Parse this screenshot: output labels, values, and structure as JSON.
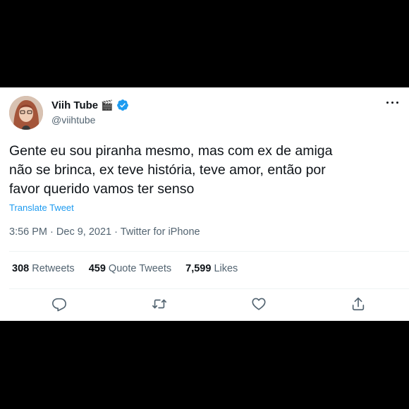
{
  "author": {
    "display_name": "Viih Tube",
    "name_emoji": "🎬",
    "handle": "@viihtube",
    "verified": true
  },
  "tweet": {
    "text": "Gente eu sou piranha mesmo, mas com ex de amiga\nnão se brinca, ex teve história, teve amor, então por\nfavor querido vamos ter senso",
    "translate_label": "Translate Tweet",
    "time": "3:56 PM",
    "date": "Dec 9, 2021",
    "source": "Twitter for iPhone",
    "separator": "·"
  },
  "stats": {
    "retweets_count": "308",
    "retweets_label": "Retweets",
    "quotes_count": "459",
    "quotes_label": "Quote Tweets",
    "likes_count": "7,599",
    "likes_label": "Likes"
  },
  "icons": {
    "more": "more-dots-icon",
    "reply": "reply-icon",
    "retweet": "retweet-icon",
    "like": "heart-icon",
    "share": "share-icon",
    "verified": "verified-badge-icon"
  },
  "colors": {
    "accent": "#1d9bf0",
    "text": "#0f1419",
    "muted": "#536471",
    "background_outer": "#000000"
  }
}
